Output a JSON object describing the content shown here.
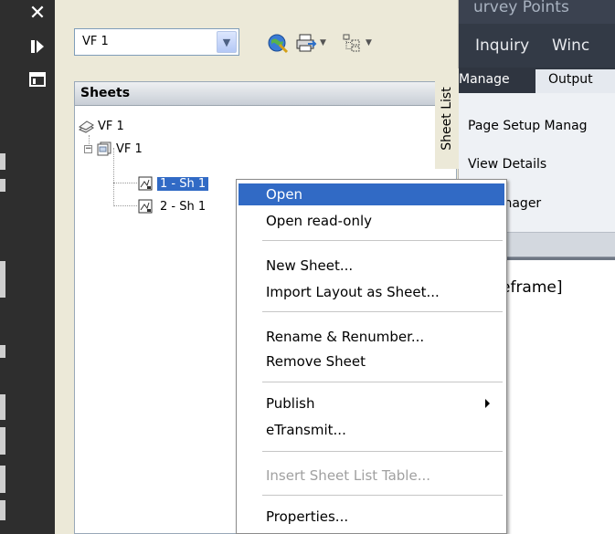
{
  "toolbar": {
    "combo_value": "VF 1"
  },
  "sheets_panel": {
    "title": "Sheets",
    "tree": [
      {
        "label": "VF 1",
        "kind": "sheet-set"
      },
      {
        "label": "VF 1",
        "kind": "subset"
      },
      {
        "label": "1 - Sh 1",
        "kind": "sheet",
        "selected": true
      },
      {
        "label": "2 - Sh 1",
        "kind": "sheet",
        "selected": false
      }
    ]
  },
  "sheet_list_tab": {
    "label": "Sheet List"
  },
  "background_app": {
    "title_fragment": "urvey  Points",
    "menu": [
      "Inquiry",
      "Winc"
    ],
    "ribbon_tabs": {
      "manage": "Manage",
      "output": "Output"
    },
    "ribbon_items": [
      "Page Setup Manag",
      "View Details",
      "er Manager"
    ],
    "document_text": "eframe]"
  },
  "context_menu": {
    "items": [
      {
        "label": "Open",
        "highlighted": true
      },
      {
        "label": "Open read-only"
      },
      {
        "label": "New Sheet..."
      },
      {
        "label": "Import Layout as Sheet..."
      },
      {
        "label": "Rename & Renumber..."
      },
      {
        "label": "Remove Sheet"
      },
      {
        "label": "Publish",
        "submenu": true
      },
      {
        "label": "eTransmit..."
      },
      {
        "label": "Insert Sheet List Table...",
        "disabled": true
      },
      {
        "label": "Properties..."
      }
    ]
  },
  "colors": {
    "selection": "#316ac5",
    "title_strip": "#2e2e2e",
    "palette_bg": "#ece9d8"
  }
}
